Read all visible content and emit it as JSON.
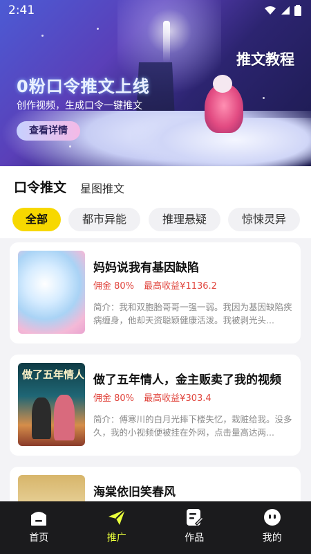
{
  "status_bar": {
    "time": "2:41"
  },
  "banner": {
    "tutorial_label": "推文教程",
    "title": "0粉口令推文上线",
    "subtitle": "创作视频，生成口令一键推文",
    "cta_label": "查看详情"
  },
  "tabs": [
    {
      "label": "口令推文",
      "active": true
    },
    {
      "label": "星图推文",
      "active": false
    }
  ],
  "filters": [
    {
      "label": "全部",
      "active": true
    },
    {
      "label": "都市异能",
      "active": false
    },
    {
      "label": "推理悬疑",
      "active": false
    },
    {
      "label": "惊悚灵异",
      "active": false
    }
  ],
  "books": [
    {
      "title": "妈妈说我有基因缺陷",
      "commission": "佣金 80%",
      "max_earnings": "最高收益¥1136.2",
      "intro": "简介：我和双胞胎哥哥一强一弱。我因为基因缺陷疾病缠身，他却天资聪颖健康活泼。我被剥光头..."
    },
    {
      "title": "做了五年情人，金主贩卖了我的视频",
      "cover_text": "做了五年情人",
      "commission": "佣金 80%",
      "max_earnings": "最高收益¥303.4",
      "intro": "简介：傅寒川的白月光摔下楼失忆，栽赃给我。没多久，我的小视频便被挂在外网，点击量高达两..."
    },
    {
      "title": "海棠依旧笑春风"
    }
  ],
  "bottom_nav": [
    {
      "label": "首页",
      "icon": "home-icon",
      "active": false
    },
    {
      "label": "推广",
      "icon": "send-icon",
      "active": true
    },
    {
      "label": "作品",
      "icon": "works-icon",
      "active": false
    },
    {
      "label": "我的",
      "icon": "profile-icon",
      "active": false
    }
  ],
  "colors": {
    "accent_yellow": "#f7d800",
    "nav_active": "#e9ff3c",
    "price_red": "#e0443c",
    "nav_bg": "#1b1b1d"
  }
}
